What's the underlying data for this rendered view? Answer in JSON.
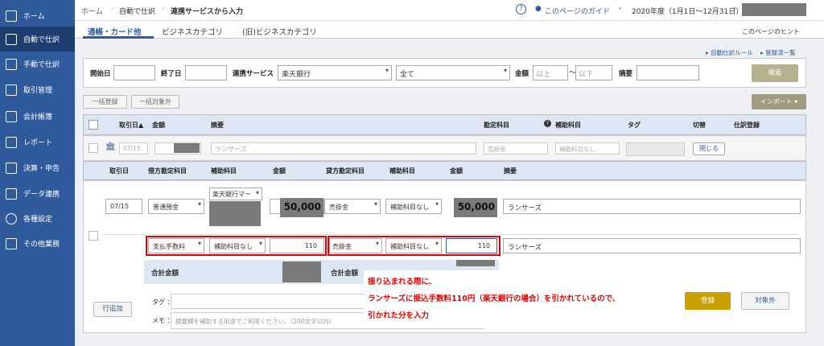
{
  "sidebar": {
    "items": [
      {
        "id": "home",
        "label": "ホーム",
        "icon": "home-icon"
      },
      {
        "id": "auto",
        "label": "自動で仕訳",
        "icon": "auto-journal-icon"
      },
      {
        "id": "manual",
        "label": "手動で仕訳",
        "icon": "manual-journal-icon"
      },
      {
        "id": "trans",
        "label": "取引管理",
        "icon": "transaction-icon"
      },
      {
        "id": "books",
        "label": "会計帳簿",
        "icon": "book-icon"
      },
      {
        "id": "report",
        "label": "レポート",
        "icon": "chart-icon"
      },
      {
        "id": "settle",
        "label": "決算・申告",
        "icon": "document-icon"
      },
      {
        "id": "link",
        "label": "データ連携",
        "icon": "monitor-icon"
      },
      {
        "id": "settings",
        "label": "各種設定",
        "icon": "gear-icon"
      },
      {
        "id": "other",
        "label": "その他業務",
        "icon": "grid-icon"
      }
    ]
  },
  "breadcrumb": [
    "ホーム",
    "自動で仕訳",
    "連携サービスから入力"
  ],
  "header": {
    "guide": "このページのガイド",
    "period": "2020年度（1月1日〜12月31日）"
  },
  "tabs": [
    "通帳・カード他",
    "ビジネスカテゴリ",
    "(旧)ビジネスカテゴリ"
  ],
  "hint": "このページのヒント",
  "links": {
    "rule": "自動仕訳ルール",
    "registered": "登録済一覧"
  },
  "filter": {
    "start": "開始日",
    "end": "終了日",
    "service": "連携サービス",
    "service_value": "楽天銀行",
    "all": "全て",
    "amount": "金額",
    "above": "以上",
    "tilde": "〜",
    "below": "以下",
    "memo": "摘要",
    "search": "検索"
  },
  "actions": {
    "bulk_register": "一括登録",
    "bulk_target": "一括対象外",
    "import": "インポート"
  },
  "table_header": {
    "date": "取引日",
    "amount": "金額",
    "memo": "摘要",
    "account": "勘定科目",
    "sub": "補助科目",
    "tag": "タグ",
    "toggle": "切替",
    "register": "仕訳登録"
  },
  "row": {
    "date": "07/15",
    "memo": "ランサーズ",
    "account": "売掛金",
    "sub": "補助科目なし",
    "close": "閉じる"
  },
  "detail": {
    "headers": {
      "date": "取引日",
      "debit": "借方勘定科目",
      "sub1": "補助科目",
      "amount1": "金額",
      "credit": "貸方勘定科目",
      "sub2": "補助科目",
      "amount2": "金額",
      "memo": "摘要"
    },
    "line1": {
      "date": "07/15",
      "debit": "普通預金",
      "sub1": "楽天銀行マー",
      "amount1": "50,000",
      "credit": "売掛金",
      "sub2": "補助科目なし",
      "amount2": "50,000",
      "memo": "ランサーズ"
    },
    "line2": {
      "debit": "支払手数料",
      "sub1": "補助科目なし",
      "amount1": "110",
      "credit": "売掛金",
      "sub2": "補助科目なし",
      "amount2": "110",
      "memo": "ランサーズ"
    },
    "total": "合計金額",
    "add_row": "行追加",
    "tag_label": "タグ",
    "memo_label": "メモ",
    "memo_placeholder": "摘要欄を補助する用途でご利用ください。（200文字以内）",
    "register": "登録",
    "exclude": "対象外"
  },
  "annotation": {
    "line1": "振り込まれる際に、",
    "line2": "ランサーズに振込手数料110円（楽天銀行の場合）を引かれているので、",
    "line3": "引かれた分を入力"
  },
  "colors": {
    "sidebar": "#2f5a9c",
    "accent": "#e20000",
    "register_btn": "#c8a100"
  }
}
